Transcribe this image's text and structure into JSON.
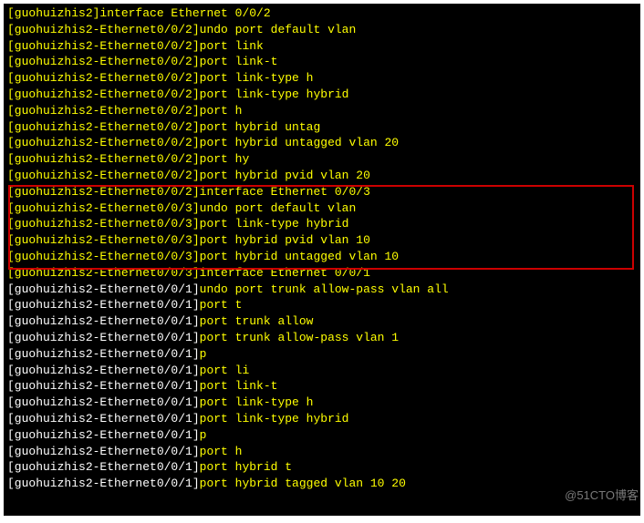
{
  "lines": [
    {
      "prompt": "[guohuizhis2]",
      "cmd": "interface Ethernet 0/0/2",
      "promptWhite": false
    },
    {
      "prompt": "[guohuizhis2-Ethernet0/0/2]",
      "cmd": "undo port default vlan",
      "promptWhite": false
    },
    {
      "prompt": "[guohuizhis2-Ethernet0/0/2]",
      "cmd": "port link",
      "promptWhite": false
    },
    {
      "prompt": "[guohuizhis2-Ethernet0/0/2]",
      "cmd": "port link-t",
      "promptWhite": false
    },
    {
      "prompt": "[guohuizhis2-Ethernet0/0/2]",
      "cmd": "port link-type h",
      "promptWhite": false
    },
    {
      "prompt": "[guohuizhis2-Ethernet0/0/2]",
      "cmd": "port link-type hybrid",
      "promptWhite": false
    },
    {
      "prompt": "[guohuizhis2-Ethernet0/0/2]",
      "cmd": "port h",
      "promptWhite": false
    },
    {
      "prompt": "[guohuizhis2-Ethernet0/0/2]",
      "cmd": "port hybrid untag",
      "promptWhite": false
    },
    {
      "prompt": "[guohuizhis2-Ethernet0/0/2]",
      "cmd": "port hybrid untagged vlan 20",
      "promptWhite": false
    },
    {
      "prompt": "[guohuizhis2-Ethernet0/0/2]",
      "cmd": "port hy",
      "promptWhite": false
    },
    {
      "prompt": "[guohuizhis2-Ethernet0/0/2]",
      "cmd": "port hybrid pvid vlan 20",
      "promptWhite": false
    },
    {
      "prompt": "[guohuizhis2-Ethernet0/0/2]",
      "cmd": "interface Ethernet 0/0/3",
      "promptWhite": false
    },
    {
      "prompt": "[guohuizhis2-Ethernet0/0/3]",
      "cmd": "undo port default vlan",
      "promptWhite": false
    },
    {
      "prompt": "[guohuizhis2-Ethernet0/0/3]",
      "cmd": "port link-type hybrid",
      "promptWhite": false
    },
    {
      "prompt": "[guohuizhis2-Ethernet0/0/3]",
      "cmd": "port hybrid pvid vlan 10",
      "promptWhite": false
    },
    {
      "prompt": "[guohuizhis2-Ethernet0/0/3]",
      "cmd": "port hybrid untagged vlan 10",
      "promptWhite": false
    },
    {
      "prompt": "[guohuizhis2-Ethernet0/0/3]",
      "cmd": "interface Ethernet 0/0/1",
      "promptWhite": false
    },
    {
      "prompt": "[guohuizhis2-Ethernet0/0/1]",
      "cmd": "undo port trunk allow-pass vlan all",
      "promptWhite": true
    },
    {
      "prompt": "[guohuizhis2-Ethernet0/0/1]",
      "cmd": "port t",
      "promptWhite": true
    },
    {
      "prompt": "[guohuizhis2-Ethernet0/0/1]",
      "cmd": "port trunk allow",
      "promptWhite": true
    },
    {
      "prompt": "[guohuizhis2-Ethernet0/0/1]",
      "cmd": "port trunk allow-pass vlan 1",
      "promptWhite": true
    },
    {
      "prompt": "[guohuizhis2-Ethernet0/0/1]",
      "cmd": "p",
      "promptWhite": true
    },
    {
      "prompt": "[guohuizhis2-Ethernet0/0/1]",
      "cmd": "port li",
      "promptWhite": true
    },
    {
      "prompt": "[guohuizhis2-Ethernet0/0/1]",
      "cmd": "port link-t",
      "promptWhite": true
    },
    {
      "prompt": "[guohuizhis2-Ethernet0/0/1]",
      "cmd": "port link-type h",
      "promptWhite": true
    },
    {
      "prompt": "[guohuizhis2-Ethernet0/0/1]",
      "cmd": "port link-type hybrid",
      "promptWhite": true
    },
    {
      "prompt": "[guohuizhis2-Ethernet0/0/1]",
      "cmd": "p",
      "promptWhite": true
    },
    {
      "prompt": "[guohuizhis2-Ethernet0/0/1]",
      "cmd": "port h",
      "promptWhite": true
    },
    {
      "prompt": "[guohuizhis2-Ethernet0/0/1]",
      "cmd": "port hybrid t",
      "promptWhite": true
    },
    {
      "prompt": "[guohuizhis2-Ethernet0/0/1]",
      "cmd": "port hybrid tagged vlan 10 20",
      "promptWhite": true
    }
  ],
  "watermark": "@51CTO博客"
}
